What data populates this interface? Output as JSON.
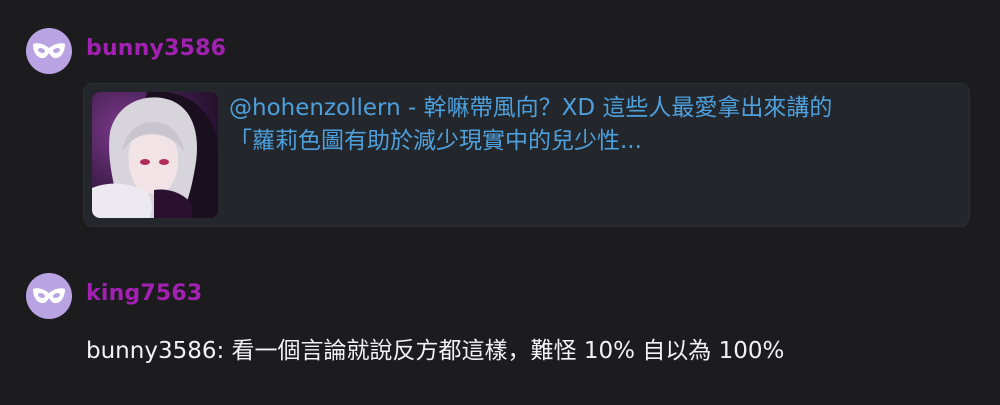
{
  "comments": [
    {
      "username": "bunny3586",
      "avatar_icon": "masquerade-mask-icon",
      "link_card": {
        "title_line1": "@hohenzollern - 幹嘛帶風向？XD 這些人最愛拿出來講的",
        "title_line2": "「蘿莉色圖有助於減少現實中的兒少性..."
      }
    },
    {
      "username": "king7563",
      "avatar_icon": "masquerade-mask-icon",
      "text": "bunny3586: 看一個言論就說反方都這樣，難怪 10% 自以為 100%"
    }
  ],
  "colors": {
    "background": "#1c1c1e",
    "username": "#a321b2",
    "avatar_bg": "#b9a3e3",
    "link_text": "#4ea0dd",
    "card_bg": "#23262b",
    "body_text": "#f2f2f2"
  }
}
